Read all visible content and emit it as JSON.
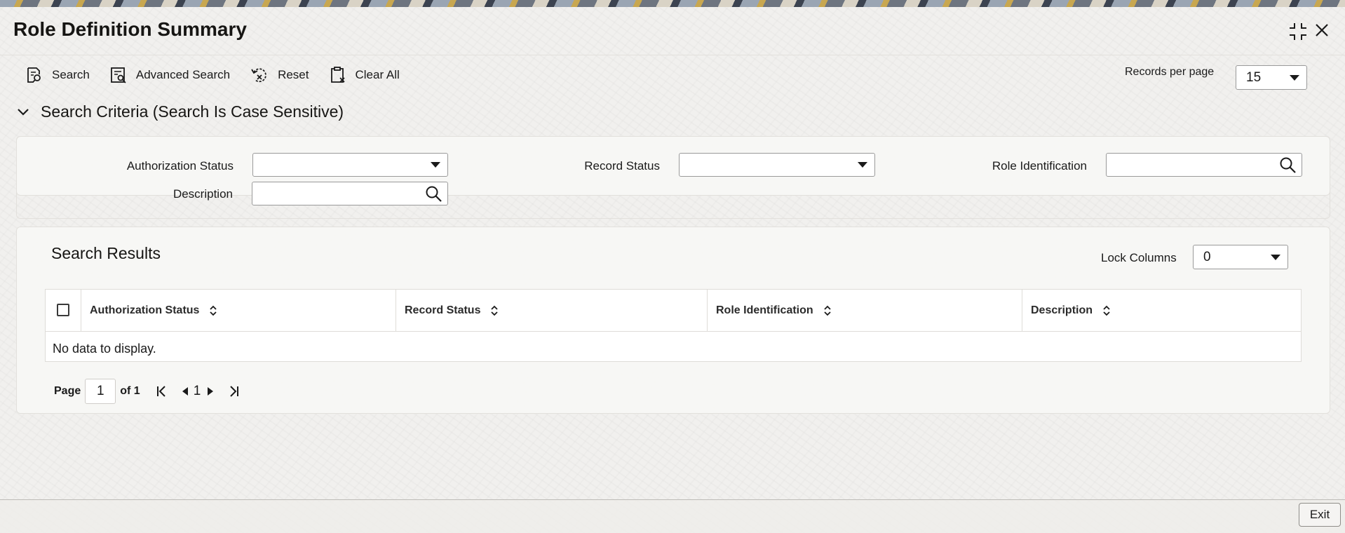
{
  "window": {
    "title": "Role Definition Summary",
    "controls": [
      "collapse-icon",
      "close-icon"
    ]
  },
  "toolbar": {
    "search_label": "Search",
    "advanced_search_label": "Advanced Search",
    "reset_label": "Reset",
    "clear_all_label": "Clear All"
  },
  "records_per_page": {
    "label": "Records per page",
    "value": "15"
  },
  "search_criteria": {
    "heading": "Search Criteria (Search Is Case Sensitive)",
    "fields": {
      "authorization_status": {
        "label": "Authorization Status",
        "value": ""
      },
      "record_status": {
        "label": "Record Status",
        "value": ""
      },
      "role_identification": {
        "label": "Role Identification",
        "value": ""
      },
      "description": {
        "label": "Description",
        "value": ""
      }
    }
  },
  "search_results": {
    "heading": "Search Results",
    "lock_columns": {
      "label": "Lock Columns",
      "value": "0"
    },
    "columns": [
      "Authorization Status",
      "Record Status",
      "Role Identification",
      "Description"
    ],
    "empty_message": "No data to display.",
    "pagination": {
      "page_label": "Page",
      "current_page": "1",
      "of_label": "of 1",
      "page_number": "1"
    }
  },
  "footer": {
    "exit_label": "Exit"
  },
  "colors": {
    "background": "#f1f0ee",
    "panel": "#f8f7f5",
    "text": "#161513",
    "border": "#9a9a9a"
  }
}
